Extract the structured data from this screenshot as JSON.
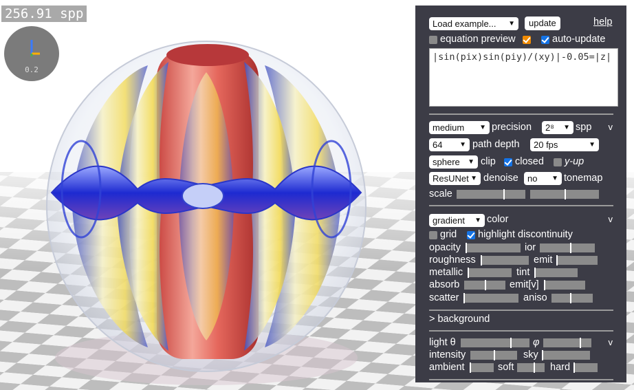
{
  "viewport": {
    "spp_readout": "256.91 spp",
    "axes_scale": "0.2"
  },
  "panel": {
    "load_example": "Load example...",
    "update_button": "update",
    "help_link": "help",
    "equation_preview_label": "equation preview",
    "equation_preview_checked": false,
    "equation_preview_extra_checked": true,
    "auto_update_label": "auto-update",
    "auto_update_checked": true,
    "equation": "|sin(pix)sin(piy)/(xy)|-0.05=|z|",
    "render": {
      "toggle": "v",
      "quality_value": "medium",
      "precision_label": "precision",
      "spp_value": "2⁸",
      "spp_label": "spp",
      "path_depth_value": "64",
      "path_depth_label": "path depth",
      "fps_value": "20 fps",
      "clip_value": "sphere",
      "clip_label": "clip",
      "closed_label": "closed",
      "closed_checked": true,
      "yup_label": "y-up",
      "yup_checked": false,
      "denoise_value": "ResUNet",
      "denoise_label": "denoise",
      "tonemap_value": "no",
      "tonemap_label": "tonemap",
      "scale_label": "scale",
      "scale_a": 0.68,
      "scale_b": 0.5
    },
    "material": {
      "toggle": "v",
      "color_value": "gradient",
      "color_label": "color",
      "grid_label": "grid",
      "grid_checked": false,
      "highlight_label": "highlight discontinuity",
      "highlight_checked": true,
      "opacity_label": "opacity",
      "opacity": 0.0,
      "ior_label": "ior",
      "ior": 0.55,
      "roughness_label": "roughness",
      "roughness": 0.0,
      "emit_label": "emit",
      "emit": 0.0,
      "metallic_label": "metallic",
      "metallic": 0.0,
      "tint_label": "tint",
      "tint": 0.0,
      "absorb_label": "absorb",
      "absorb": 0.5,
      "emitv_label": "emit[v]",
      "emitv": 0.0,
      "scatter_label": "scatter",
      "scatter": 0.0,
      "aniso_label": "aniso",
      "aniso": 0.45
    },
    "background_label": "> background",
    "light": {
      "toggle": "v",
      "theta_label": "light θ",
      "theta": 0.72,
      "phi_label": "φ",
      "phi": 0.75,
      "intensity_label": "intensity",
      "intensity": 0.5,
      "sky_label": "sky",
      "sky": 0.0,
      "ambient_label": "ambient",
      "ambient": 0.0,
      "soft_label": "soft",
      "soft": 0.6,
      "hard_label": "hard",
      "hard": 0.0
    }
  }
}
